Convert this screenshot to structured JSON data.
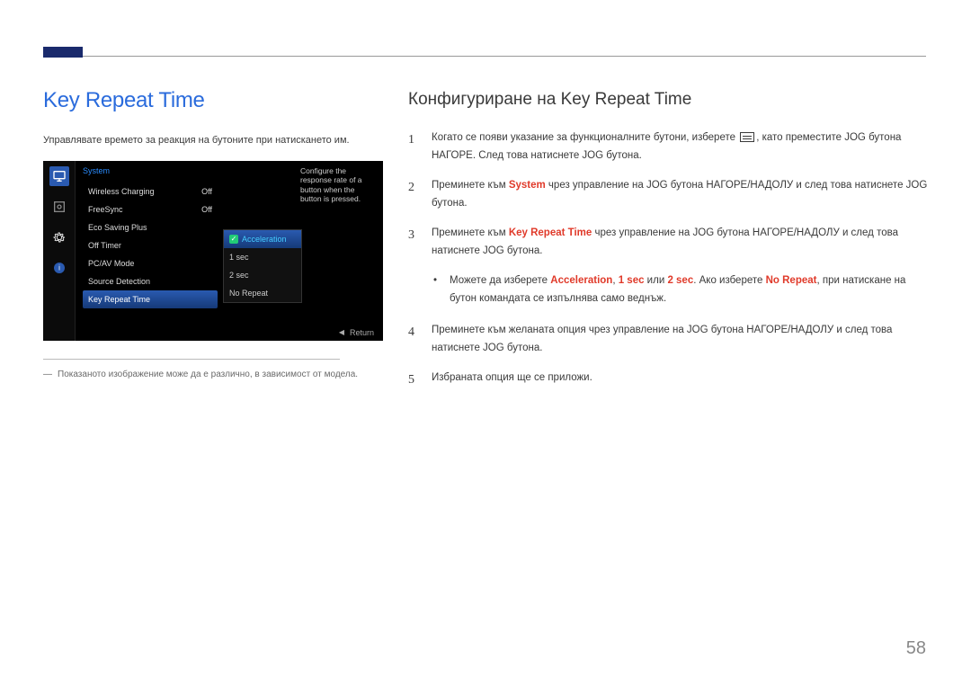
{
  "page_number": "58",
  "left": {
    "title": "Key Repeat Time",
    "description": "Управлявате времето за реакция на бутоните при натискането им.",
    "footnote": "Показаното изображение може да е различно, в зависимост от модела."
  },
  "osd": {
    "header": "System",
    "tip": "Configure the response rate of a button when the button is pressed.",
    "items": [
      {
        "label": "Wireless Charging",
        "value": "Off"
      },
      {
        "label": "FreeSync",
        "value": "Off"
      },
      {
        "label": "Eco Saving Plus",
        "value": ""
      },
      {
        "label": "Off Timer",
        "value": ""
      },
      {
        "label": "PC/AV Mode",
        "value": ""
      },
      {
        "label": "Source Detection",
        "value": ""
      },
      {
        "label": "Key Repeat Time",
        "value": ""
      }
    ],
    "options": [
      "Acceleration",
      "1 sec",
      "2 sec",
      "No Repeat"
    ],
    "footer": "Return"
  },
  "right": {
    "section_title": "Конфигуриране на Key Repeat Time",
    "steps": {
      "s1a": "Когато се появи указание за функционалните бутони, изберете ",
      "s1b": ", като преместите JOG бутона НАГОРЕ. След това натиснете JOG бутона.",
      "s2a": "Преминете към ",
      "s2_hl": "System",
      "s2b": " чрез управление на JOG бутона НАГОРЕ/НАДОЛУ и след това натиснете JOG бутона.",
      "s3a": "Преминете към ",
      "s3_hl": "Key Repeat Time",
      "s3b": " чрез управление на JOG бутона НАГОРЕ/НАДОЛУ и след това натиснете JOG бутона.",
      "bullet_a": "Можете да изберете ",
      "bullet_o1": "Acceleration",
      "bullet_sep1": ", ",
      "bullet_o2": "1 sec",
      "bullet_sep2": " или ",
      "bullet_o3": "2 sec",
      "bullet_mid": ". Ако изберете ",
      "bullet_o4": "No Repeat",
      "bullet_b": ", при натискане на бутон командата се изпълнява само веднъж.",
      "s4": "Преминете към желаната опция чрез управление на JOG бутона НАГОРЕ/НАДОЛУ и след това натиснете JOG бутона.",
      "s5": "Избраната опция ще се приложи."
    },
    "nums": {
      "n1": "1",
      "n2": "2",
      "n3": "3",
      "n4": "4",
      "n5": "5"
    }
  }
}
